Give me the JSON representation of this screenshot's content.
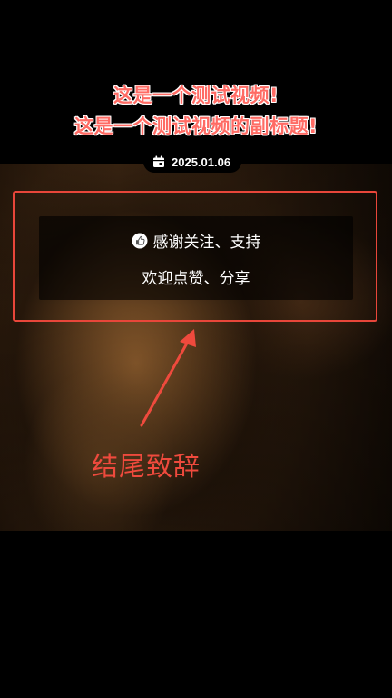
{
  "title": {
    "line1": "这是一个测试视频!",
    "line2": "这是一个测试视频的副标题!"
  },
  "date": {
    "icon": "calendar-icon",
    "text": "2025.01.06"
  },
  "thanks_card": {
    "icon": "thumbs-up-icon",
    "line1": "感谢关注、支持",
    "line2": "欢迎点赞、分享"
  },
  "annotation": {
    "label": "结尾致辞",
    "color": "#ef4a3d"
  },
  "colors": {
    "title_text": "#ff6b64",
    "title_outline": "#ffffff",
    "highlight_border": "#e8463a",
    "background": "#000000"
  }
}
